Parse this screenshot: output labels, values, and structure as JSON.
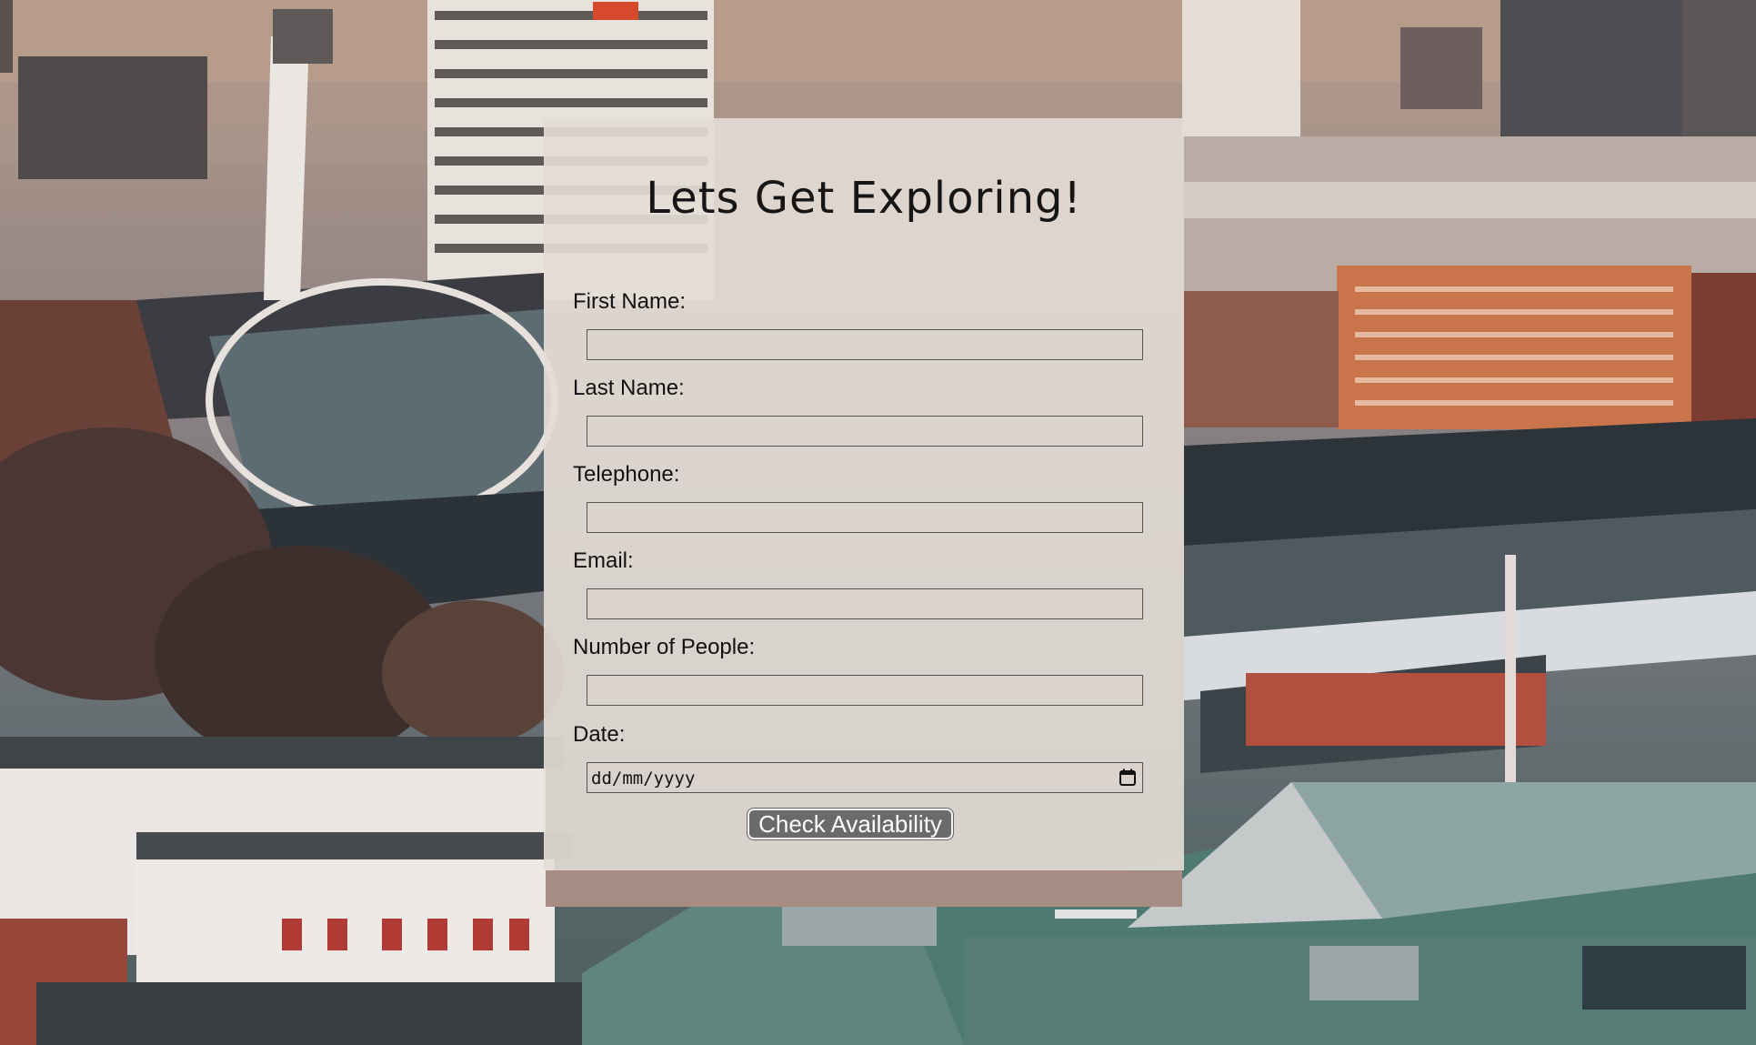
{
  "form": {
    "title": "Lets Get Exploring!",
    "fields": [
      {
        "label": "First Name:",
        "value": ""
      },
      {
        "label": "Last Name:",
        "value": ""
      },
      {
        "label": "Telephone:",
        "value": ""
      },
      {
        "label": "Email:",
        "value": ""
      },
      {
        "label": "Number of People:",
        "value": ""
      },
      {
        "label": "Date:",
        "placeholder": "dd/mm/yyyy"
      }
    ],
    "submit_label": "Check Availability"
  },
  "colors": {
    "card_background": "#e4ded6",
    "button_background": "#6a6a6a",
    "button_text": "#ffffff"
  },
  "icons": {
    "date_picker": "calendar-icon"
  }
}
